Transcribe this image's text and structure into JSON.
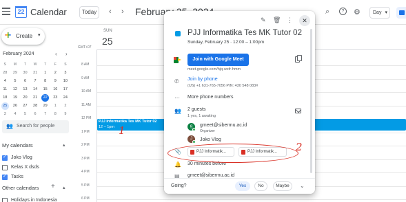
{
  "header": {
    "app_title": "Calendar",
    "logo_day": "22",
    "today_label": "Today",
    "prev_arrow": "‹",
    "next_arrow": "›",
    "date_title": "February 25, 2024",
    "view_label": "Day"
  },
  "sidebar": {
    "create_label": "Create",
    "mini_cal": {
      "title": "February 2024",
      "weekdays": [
        "S",
        "M",
        "T",
        "W",
        "T",
        "F",
        "S"
      ],
      "weeks": [
        [
          "28",
          "29",
          "30",
          "31",
          "1",
          "2",
          "3"
        ],
        [
          "4",
          "5",
          "6",
          "7",
          "8",
          "9",
          "10"
        ],
        [
          "11",
          "12",
          "13",
          "14",
          "15",
          "16",
          "17"
        ],
        [
          "18",
          "19",
          "20",
          "21",
          "22",
          "23",
          "24"
        ],
        [
          "25",
          "26",
          "27",
          "28",
          "29",
          "1",
          "2"
        ],
        [
          "3",
          "4",
          "5",
          "6",
          "7",
          "8",
          "9"
        ]
      ],
      "today": "22",
      "selected": "25"
    },
    "search_people": "Search for people",
    "my_calendars_title": "My calendars",
    "my_calendars": [
      {
        "label": "Joko Vlog",
        "checked": true
      },
      {
        "label": "Kelas X dsds",
        "checked": false
      },
      {
        "label": "Tasks",
        "checked": true
      }
    ],
    "other_calendars_title": "Other calendars",
    "other_calendars": [
      {
        "label": "Holidays in Indonesia",
        "checked": false
      }
    ]
  },
  "day_view": {
    "day_name": "SUN",
    "day_number": "25",
    "timezone": "GMT+07",
    "hours": [
      "8 AM",
      "9 AM",
      "10 AM",
      "11 AM",
      "12 PM",
      "1 PM",
      "2 PM",
      "3 PM",
      "4 PM",
      "5 PM",
      "6 PM"
    ],
    "event_title": "PJJ Informatika Tes MK Tutor 02",
    "event_time": "12 – 1pm"
  },
  "popup": {
    "title": "PJJ Informatika Tes MK Tutor 02",
    "datetime": "Sunday, February 25  ·  12:00 – 1:00pm",
    "join_meet": "Join with Google Meet",
    "meet_url": "meet.google.com/hjq-wxfr-hmm",
    "join_phone": "Join by phone",
    "phone_detail": "(US) +1 631-765-7056 PIN: 430 548 083#",
    "more_phone": "More phone numbers",
    "guests_count": "2 guests",
    "guests_sub": "1 yes, 1 awaiting",
    "guests": [
      {
        "initial": "g",
        "name": "gmeet@sibermu.ac.id",
        "role": "Organizer"
      },
      {
        "initial": "J",
        "name": "Joko Vlog",
        "role": ""
      }
    ],
    "attachments": [
      "PJJ Informatik...",
      "PJJ Informatik..."
    ],
    "reminder": "30 minutes before",
    "organizer_email": "gmeet@sibermu.ac.id",
    "going_label": "Going?",
    "rsvp_yes": "Yes",
    "rsvp_no": "No",
    "rsvp_maybe": "Maybe"
  },
  "annotations": {
    "mark_1": "1",
    "mark_2": "2"
  },
  "colors": {
    "event": "#039be5",
    "primary": "#1a73e8",
    "annotation": "#d93025"
  }
}
